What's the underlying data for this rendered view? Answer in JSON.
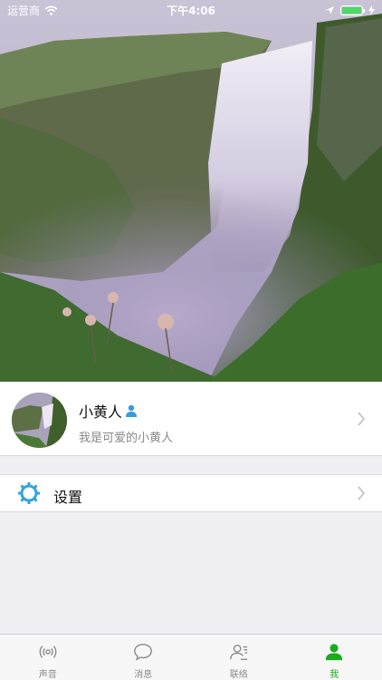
{
  "status_bar": {
    "carrier": "运营商",
    "time": "下午4:06",
    "battery_color": "#4cd964"
  },
  "hero": {
    "image_subject": "waterfall-landscape"
  },
  "profile": {
    "name": "小黄人",
    "subtitle": "我是可爱的小黄人",
    "badge_icon": "person-badge-icon"
  },
  "menu": {
    "settings_label": "设置",
    "settings_icon": "gear-icon"
  },
  "tabbar": {
    "active_color": "#1aad19",
    "inactive_color": "#8a8a8a",
    "tabs": [
      {
        "label": "声音",
        "icon": "broadcast-icon"
      },
      {
        "label": "消息",
        "icon": "chat-bubble-icon"
      },
      {
        "label": "联络",
        "icon": "contacts-icon"
      },
      {
        "label": "我",
        "icon": "person-icon"
      }
    ]
  }
}
